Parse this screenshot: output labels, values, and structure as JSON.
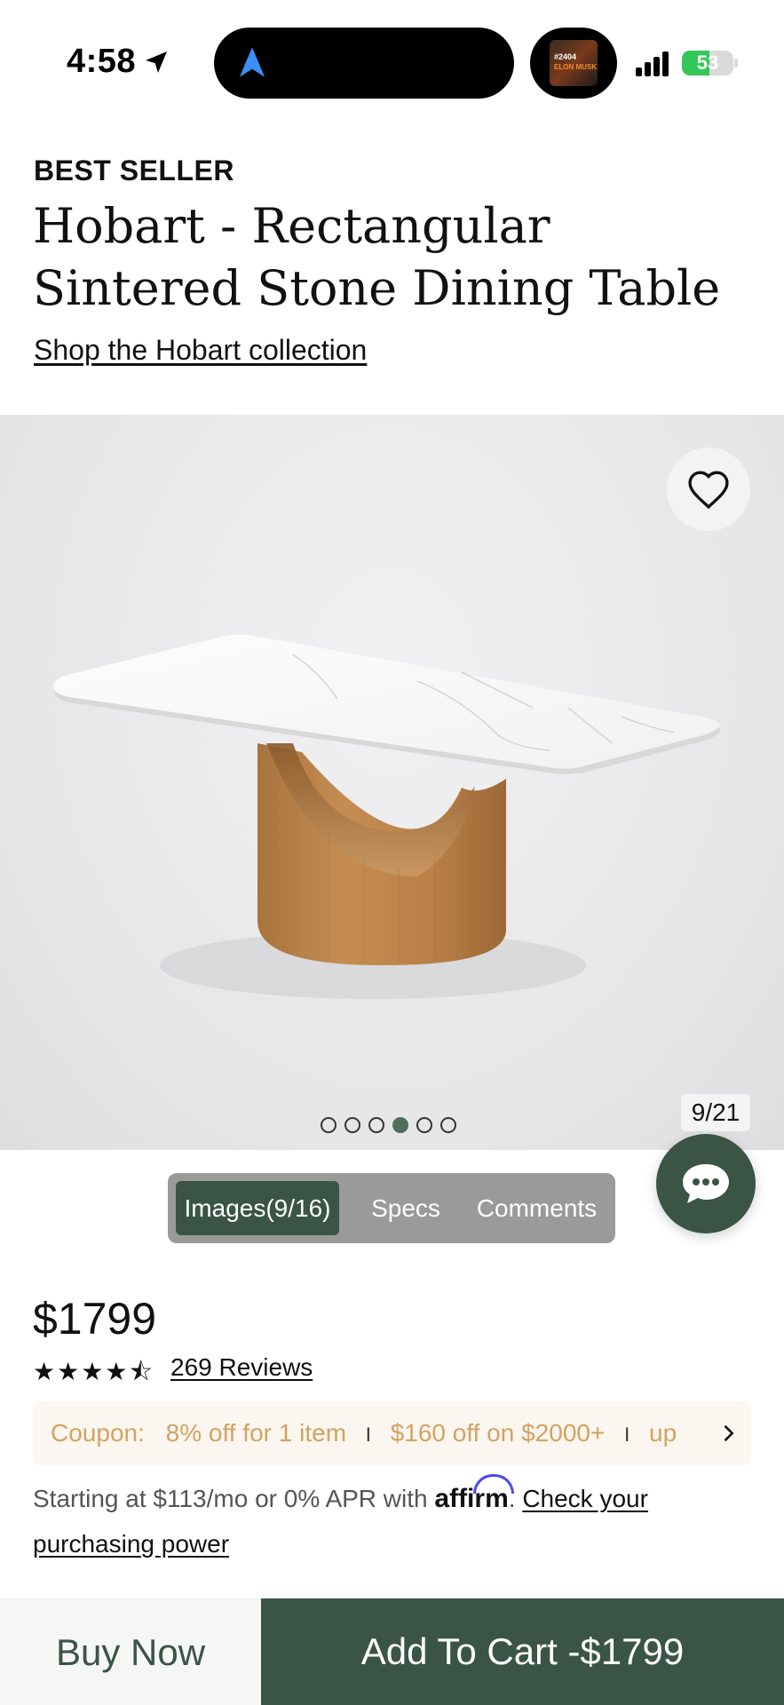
{
  "status_bar": {
    "time": "4:58",
    "battery": "53",
    "battery_level": 0.53,
    "island_art_number": "#2404",
    "island_art_name": "ELON MUSK",
    "icons": [
      "location-arrow-icon",
      "navigation-icon",
      "signal-icon",
      "battery-icon"
    ]
  },
  "product": {
    "badge": "BEST SELLER",
    "title": "Hobart - Rectangular Sintered Stone Dining Table",
    "collection_link": "Shop the Hobart collection",
    "price": "$1799",
    "rating": 4.5,
    "stars": "★★★★⯪",
    "reviews": "269 Reviews"
  },
  "gallery": {
    "counter": "9/21",
    "dot_count": 6,
    "active_dot": 3
  },
  "tabs": [
    {
      "label": "Images(9/16)",
      "active": true
    },
    {
      "label": "Specs",
      "active": false
    },
    {
      "label": "Comments",
      "active": false
    }
  ],
  "coupon": {
    "label": "Coupon:",
    "offer1": "8% off for 1 item",
    "offer2": "$160 off on $2000+",
    "offer3": "up"
  },
  "affirm": {
    "prefix": "Starting at $113/mo or 0% APR with",
    "brand": "affirm",
    "link": "Check your purchasing power"
  },
  "actions": {
    "buy_now": "Buy Now",
    "add_to_cart": "Add To Cart -$1799"
  },
  "colors": {
    "brand_green": "#3a5445",
    "coupon_text": "#d3a361",
    "coupon_bg": "#fbf6ef",
    "affirm_blue": "#4a4af4"
  }
}
